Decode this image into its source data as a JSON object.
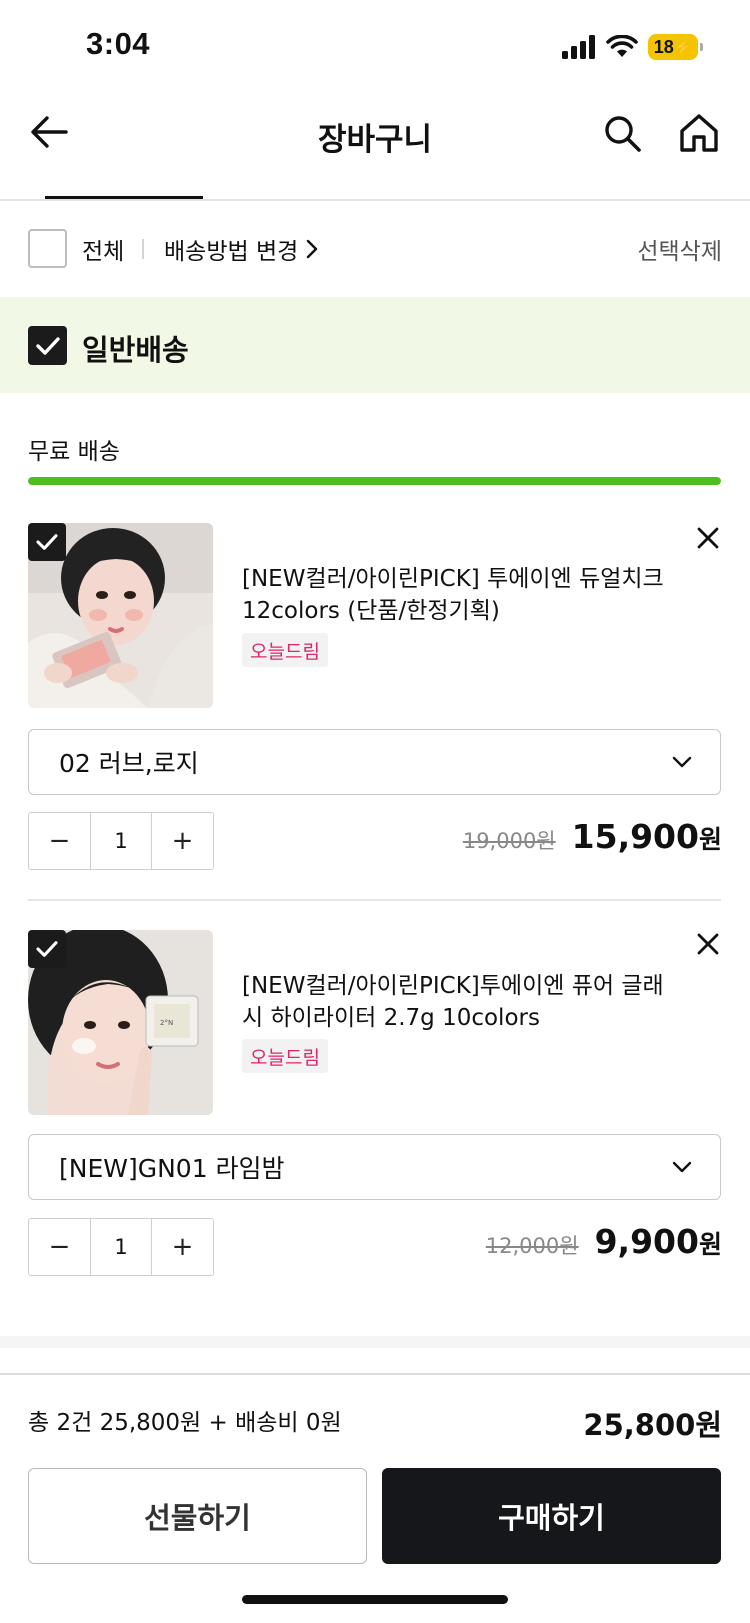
{
  "status_bar": {
    "time": "3:04",
    "battery": "18"
  },
  "header": {
    "title": "장바구니",
    "icons": [
      "back-arrow-icon",
      "search-icon",
      "home-icon"
    ]
  },
  "select_row": {
    "all_label": "전체",
    "shipping_method": "배송방법 변경",
    "delete_selected": "선택삭제"
  },
  "section": {
    "title": "일반배송",
    "free_shipping": "무료 배송",
    "free_shipping_progress": 1.0
  },
  "items": [
    {
      "name": "[NEW컬러/아이린PICK] 투에이엔 듀얼치크 12colors (단품/한정기획)",
      "badge": "오늘드림",
      "option": "02 러브,로지",
      "qty": "1",
      "original_price": "19,000원",
      "price": "15,900",
      "currency": "원"
    },
    {
      "name": "[NEW컬러/아이린PICK]투에이엔 퓨어 글래시 하이라이터 2.7g 10colors",
      "badge": "오늘드림",
      "option": "[NEW]GN01 라임밤",
      "qty": "1",
      "original_price": "12,000원",
      "price": "9,900",
      "currency": "원"
    }
  ],
  "footer": {
    "summary": "총 2건 25,800원 + 배송비 0원",
    "total": "25,800원",
    "gift_button": "선물하기",
    "buy_button": "구매하기"
  },
  "colors": {
    "accent_green": "#4dbd1f",
    "band_bg": "#f1f9e6",
    "badge_pink": "#e0246a",
    "buy_bg": "#16171a"
  }
}
